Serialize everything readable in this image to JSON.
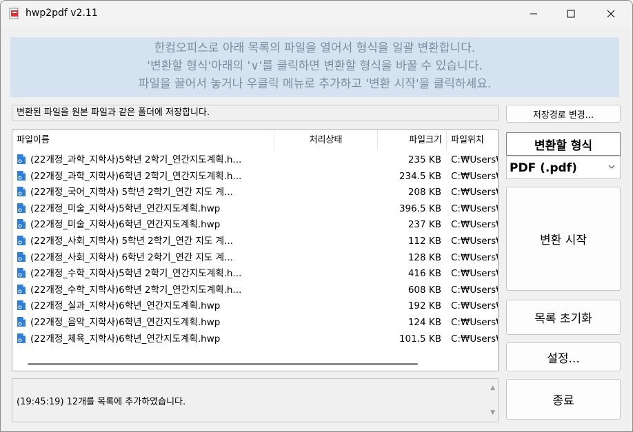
{
  "window": {
    "title": "hwp2pdf v2.11"
  },
  "banner": {
    "line1": "한컴오피스로 아래 목록의 파일을 열어서 형식을 일괄 변환합니다.",
    "line2": "'변환할 형식'아래의 '∨'를 클릭하면 변환할 형식을 바꿀 수 있습니다.",
    "line3": "파일을 끌어서 놓거나 우클릭 메뉴로 추가하고 '변환 시작'을 클릭하세요."
  },
  "save_info": "변환된 파일을 원본 파일과 같은 폴더에 저장합니다.",
  "save_path_button": "저장경로 변경...",
  "list": {
    "columns": {
      "name": "파일이름",
      "status": "처리상태",
      "size": "파일크기",
      "location": "파일위치"
    },
    "rows": [
      {
        "name": "(22개정_과학_지학사)5학년 2학기_연간지도계획.h...",
        "size": "235 KB",
        "location": "C:₩Users₩"
      },
      {
        "name": "(22개정_과학_지학사)6학년 2학기_연간지도계획.h...",
        "size": "234.5 KB",
        "location": "C:₩Users₩"
      },
      {
        "name": "(22개정_국어_지학사) 5학년 2학기_연간 지도 계...",
        "size": "208 KB",
        "location": "C:₩Users₩"
      },
      {
        "name": "(22개정_미술_지학사)5학년_연간지도계획.hwp",
        "size": "396.5 KB",
        "location": "C:₩Users₩"
      },
      {
        "name": "(22개정_미술_지학사)6학년_연간지도계획.hwp",
        "size": "237 KB",
        "location": "C:₩Users₩"
      },
      {
        "name": "(22개정_사회_지학사) 5학년 2학기_연간 지도 계...",
        "size": "112 KB",
        "location": "C:₩Users₩"
      },
      {
        "name": "(22개정_사회_지학사) 6학년 2학기_연간 지도 계...",
        "size": "128 KB",
        "location": "C:₩Users₩"
      },
      {
        "name": "(22개정_수학_지학사)5학년 2학기_연간지도계획.h...",
        "size": "416 KB",
        "location": "C:₩Users₩"
      },
      {
        "name": "(22개정_수학_지학사)6학년 2학기_연간지도계획.h...",
        "size": "608 KB",
        "location": "C:₩Users₩"
      },
      {
        "name": "(22개정_실과_지학사)6학년_연간지도계획.hwp",
        "size": "192 KB",
        "location": "C:₩Users₩"
      },
      {
        "name": "(22개정_음악_지학사)6학년_연간지도계획.hwp",
        "size": "124 KB",
        "location": "C:₩Users₩"
      },
      {
        "name": "(22개정_체육_지학사)6학년_연간지도계획.hwp",
        "size": "101.5 KB",
        "location": "C:₩Users₩"
      }
    ]
  },
  "status": "(19:45:19) 12개를 목록에 추가하였습니다.",
  "format": {
    "label": "변환할 형식",
    "value": "PDF (.pdf)"
  },
  "buttons": {
    "start": "변환 시작",
    "clear": "목록 초기화",
    "settings": "설정...",
    "exit": "종료"
  },
  "icons": {
    "app": "hwp2pdf-app-icon",
    "file": "hwp-file-icon",
    "minimize": "minimize-icon",
    "maximize": "maximize-icon",
    "close": "close-icon",
    "dropdown": "chevron-down-icon"
  },
  "colors": {
    "banner_bg": "#d5e2ef",
    "banner_text": "#7d8ea0",
    "file_icon": "#2f7fd8"
  }
}
